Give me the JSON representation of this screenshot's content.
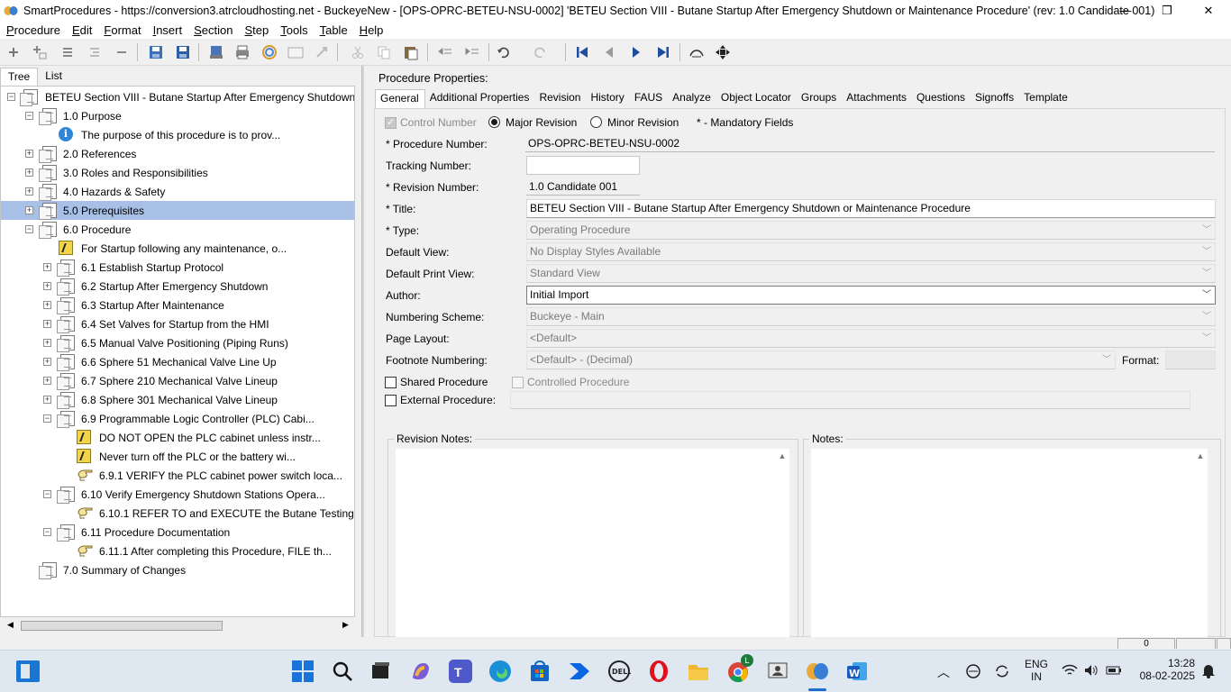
{
  "window": {
    "title": "SmartProcedures - https://conversion3.atrcloudhosting.net - BuckeyeNew - [OPS-OPRC-BETEU-NSU-0002] 'BETEU Section VIII - Butane Startup After Emergency Shutdown or Maintenance Procedure' (rev: 1.0 Candidate 001)",
    "controls": {
      "minimize": "—",
      "restore": "❐",
      "close": "✕"
    }
  },
  "menu": [
    {
      "label": "Procedure",
      "accel": "P",
      "rest": "rocedure"
    },
    {
      "label": "Edit",
      "accel": "E",
      "rest": "dit"
    },
    {
      "label": "Format",
      "accel": "F",
      "rest": "ormat"
    },
    {
      "label": "Insert",
      "accel": "I",
      "rest": "nsert"
    },
    {
      "label": "Section",
      "accel": "S",
      "rest": "ection"
    },
    {
      "label": "Step",
      "accel": "S",
      "rest": "tep"
    },
    {
      "label": "Tools",
      "accel": "T",
      "rest": "ools"
    },
    {
      "label": "Table",
      "accel": "T",
      "rest": "able"
    },
    {
      "label": "Help",
      "accel": "H",
      "rest": "elp"
    }
  ],
  "toolbar": {
    "icons": [
      "add-icon",
      "add-child-icon",
      "list-icon",
      "indent-list-icon",
      "remove-icon",
      "save-all-icon",
      "save-icon",
      "publish-icon",
      "print-icon",
      "refresh-icon",
      "page-icon",
      "link-icon",
      "cut-icon",
      "copy-icon",
      "paste-icon",
      "outdent-icon",
      "indent-icon",
      "undo-icon",
      "redo-icon",
      "first-icon",
      "previous-icon",
      "next-icon",
      "last-icon",
      "find-icon",
      "move-icon"
    ]
  },
  "left_panel": {
    "tabs": [
      "Tree",
      "List"
    ],
    "active_tab": "Tree",
    "tree": [
      {
        "label": "BETEU Section VIII - Butane Startup After Emergency Shutdown...",
        "icon": "document-icon",
        "expander": "−",
        "level": 0
      },
      {
        "label": "1.0 Purpose",
        "icon": "document-icon",
        "expander": "−",
        "level": 1
      },
      {
        "label": "The purpose of this procedure is to prov...",
        "icon": "info-icon",
        "expander": "",
        "level": 2
      },
      {
        "label": "2.0 References",
        "icon": "document-icon",
        "expander": "+",
        "level": 1
      },
      {
        "label": "3.0 Roles and Responsibilities",
        "icon": "document-icon",
        "expander": "+",
        "level": 1
      },
      {
        "label": "4.0 Hazards & Safety",
        "icon": "document-icon",
        "expander": "+",
        "level": 1
      },
      {
        "label": "5.0 Prerequisites",
        "icon": "document-icon",
        "expander": "+",
        "level": 1,
        "selected": true
      },
      {
        "label": "6.0 Procedure",
        "icon": "document-icon",
        "expander": "−",
        "level": 1
      },
      {
        "label": "For Startup following any maintenance, o...",
        "icon": "caution-icon",
        "expander": "",
        "level": 2
      },
      {
        "label": "6.1 Establish Startup Protocol",
        "icon": "document-icon",
        "expander": "+",
        "level": 2
      },
      {
        "label": "6.2 Startup After Emergency Shutdown",
        "icon": "document-icon",
        "expander": "+",
        "level": 2
      },
      {
        "label": "6.3 Startup After Maintenance",
        "icon": "document-icon",
        "expander": "+",
        "level": 2
      },
      {
        "label": "6.4 Set Valves for Startup from the HMI",
        "icon": "document-icon",
        "expander": "+",
        "level": 2
      },
      {
        "label": "6.5 Manual Valve Positioning (Piping Runs)",
        "icon": "document-icon",
        "expander": "+",
        "level": 2
      },
      {
        "label": "6.6 Sphere 51 Mechanical Valve Line Up",
        "icon": "document-icon",
        "expander": "+",
        "level": 2
      },
      {
        "label": "6.7 Sphere 210 Mechanical Valve Lineup",
        "icon": "document-icon",
        "expander": "+",
        "level": 2
      },
      {
        "label": "6.8 Sphere 301 Mechanical Valve Lineup",
        "icon": "document-icon",
        "expander": "+",
        "level": 2
      },
      {
        "label": "6.9 Programmable Logic Controller (PLC) Cabi...",
        "icon": "document-icon",
        "expander": "−",
        "level": 2
      },
      {
        "label": "DO NOT OPEN the PLC cabinet unless instr...",
        "icon": "caution-icon",
        "expander": "",
        "level": 3
      },
      {
        "label": "Never turn off the PLC or the battery wi...",
        "icon": "caution-icon",
        "expander": "",
        "level": 3
      },
      {
        "label": "6.9.1 VERIFY the PLC cabinet power switch loca...",
        "icon": "pointing-hand-icon",
        "expander": "",
        "level": 3
      },
      {
        "label": "6.10 Verify Emergency Shutdown Stations Opera...",
        "icon": "document-icon",
        "expander": "−",
        "level": 2
      },
      {
        "label": "6.10.1 REFER TO and EXECUTE the Butane Testing ...",
        "icon": "pointing-hand-icon",
        "expander": "",
        "level": 3
      },
      {
        "label": "6.11 Procedure Documentation",
        "icon": "document-icon",
        "expander": "−",
        "level": 2
      },
      {
        "label": "6.11.1 After completing this Procedure, FILE th...",
        "icon": "pointing-hand-icon",
        "expander": "",
        "level": 3
      },
      {
        "label": "7.0 Summary of Changes",
        "icon": "document-icon",
        "expander": "",
        "level": 1
      }
    ],
    "scroll_left": "◀",
    "scroll_right": "▶"
  },
  "right_panel": {
    "heading": "Procedure Properties:",
    "tabs": [
      "General",
      "Additional Properties",
      "Revision",
      "History",
      "FAUS",
      "Analyze",
      "Object Locator",
      "Groups",
      "Attachments",
      "Questions",
      "Signoffs",
      "Template"
    ],
    "active_tab": "General",
    "control_number_label": "Control Number",
    "major_revision_label": "Major Revision",
    "minor_revision_label": "Minor Revision",
    "mandatory_note": "* - Mandatory Fields",
    "fields": {
      "procedure_number": {
        "label": "* Procedure Number:",
        "value": "OPS-OPRC-BETEU-NSU-0002"
      },
      "tracking_number": {
        "label": "Tracking Number:",
        "value": ""
      },
      "revision_number": {
        "label": "* Revision Number:",
        "value": "1.0 Candidate 001"
      },
      "title": {
        "label": "* Title:",
        "value": "BETEU Section VIII - Butane Startup After Emergency Shutdown or Maintenance Procedure"
      },
      "type": {
        "label": "* Type:",
        "value": "Operating Procedure"
      },
      "default_view": {
        "label": "Default View:",
        "value": "No Display Styles Available"
      },
      "default_print_view": {
        "label": "Default Print View:",
        "value": "Standard View"
      },
      "author": {
        "label": "Author:",
        "value": "Initial Import"
      },
      "numbering_scheme": {
        "label": "Numbering Scheme:",
        "value": "Buckeye - Main"
      },
      "page_layout": {
        "label": "Page Layout:",
        "value": "<Default>"
      },
      "footnote_numbering": {
        "label": "Footnote Numbering:",
        "value": "<Default> - (Decimal)"
      },
      "format": {
        "label": "Format:",
        "value": ""
      }
    },
    "shared_procedure_label": "Shared Procedure",
    "controlled_procedure_label": "Controlled Procedure",
    "external_procedure_label": "External Procedure:",
    "revision_notes_label": "Revision Notes:",
    "notes_label": "Notes:"
  },
  "status_bar": {
    "count": "0"
  },
  "taskbar": {
    "apps": [
      "start-icon",
      "task-view-icon",
      "windows-logo-icon",
      "search-icon",
      "terminal-icon",
      "copilot-icon",
      "teams-icon",
      "edge-icon",
      "store-icon",
      "power-automate-icon",
      "dell-icon",
      "opera-icon",
      "file-explorer-icon",
      "chrome-icon",
      "remote-desktop-icon",
      "smartprocedures-icon",
      "word-icon"
    ],
    "language_top": "ENG",
    "language_bottom": "IN",
    "time": "13:28",
    "date": "08-02-2025",
    "chrome_badge": "L"
  }
}
